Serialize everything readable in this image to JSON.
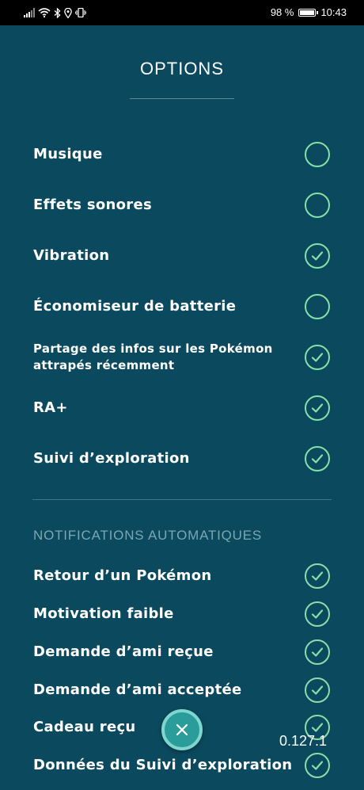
{
  "status_bar": {
    "icons": [
      "signal-icon",
      "wifi-icon",
      "bluetooth-icon",
      "location-icon",
      "vibrate-icon"
    ],
    "battery_percent": "98 %",
    "battery_level": 0.98,
    "time": "10:43"
  },
  "header": {
    "title": "OPTIONS"
  },
  "options": [
    {
      "label": "Musique",
      "checked": false
    },
    {
      "label": "Effets sonores",
      "checked": false
    },
    {
      "label": "Vibration",
      "checked": true
    },
    {
      "label": "Économiseur de batterie",
      "checked": false
    },
    {
      "label": "Partage des infos sur les Pokémon attrapés récemment",
      "checked": true
    },
    {
      "label": "RA+",
      "checked": true
    },
    {
      "label": "Suivi d’exploration",
      "checked": true
    }
  ],
  "notifications": {
    "title": "NOTIFICATIONS AUTOMATIQUES",
    "items": [
      {
        "label": "Retour d’un Pokémon",
        "checked": true
      },
      {
        "label": "Motivation faible",
        "checked": true
      },
      {
        "label": "Demande d’ami reçue",
        "checked": true
      },
      {
        "label": "Demande d’ami acceptée",
        "checked": true
      },
      {
        "label": "Cadeau reçu",
        "checked": true
      },
      {
        "label": "Données du Suivi d’exploration",
        "checked": true
      }
    ]
  },
  "version": "0.127.1",
  "colors": {
    "background": "#0b4a5e",
    "accent": "#88dfa8",
    "close_button": "#2a9d9a",
    "section_title": "#7ba6b2"
  }
}
